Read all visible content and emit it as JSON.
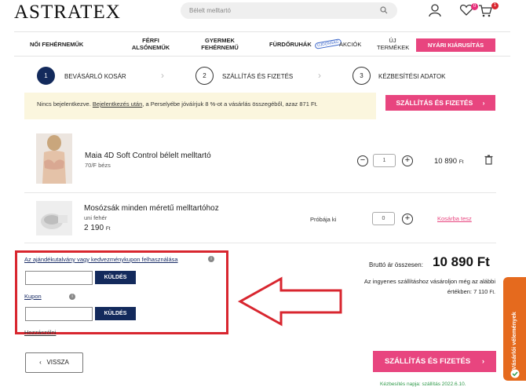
{
  "header": {
    "logo": "ASTRATEX",
    "search": {
      "placeholder": "Bélelt melltartó"
    },
    "wishlist_count": "0",
    "cart_count": "1"
  },
  "nav": {
    "items": [
      {
        "label": "NŐI FEHÉRNEMŰK"
      },
      {
        "label": "FÉRFI ALSÓNEMŰK"
      },
      {
        "label": "GYERMEK FEHÉRNEMŰ"
      },
      {
        "label": "FÜRDŐRUHÁK"
      },
      {
        "label": "AKCIÓK"
      },
      {
        "label": "ÚJ TERMÉKEK"
      }
    ],
    "new_tag": "ÚJDONSÁG",
    "sale_label": "NYÁRI KIÁRUSÍTÁS"
  },
  "steps": [
    {
      "num": "1",
      "label": "BEVÁSÁRLÓ KOSÁR"
    },
    {
      "num": "2",
      "label": "SZÁLLÍTÁS ÉS FIZETÉS"
    },
    {
      "num": "3",
      "label": "KÉZBESÍTÉSI ADATOK"
    }
  ],
  "notice": {
    "prefix": "Nincs bejelentkezve.",
    "link": "Bejelentkezés után",
    "rest": ", a Perselyébe jóváírjuk 8 %-ot a vásárlás összegéből, azaz 871 Ft.",
    "button": "SZÁLLÍTÁS ÉS FIZETÉS"
  },
  "products": [
    {
      "name": "Maia 4D Soft Control bélelt melltartó",
      "variant": "70/F bézs",
      "qty": "1",
      "price": "10 890",
      "currency": "Ft"
    },
    {
      "name": "Mosózsák minden méretű melltartóhoz",
      "variant": "uni fehér",
      "price_line": "2 190",
      "currency": "Ft",
      "try_label": "Próbája ki",
      "qty": "0",
      "add_to_cart": "Kosárba tesz"
    }
  ],
  "coupon": {
    "gift_label": "Az ajándékutalvány vagy kedvezménykupon felhasználása",
    "gift_button": "KÜLDÉS",
    "coupon_label": "Kupon",
    "coupon_button": "KÜLDÉS",
    "extra_link": "Hozzászólni"
  },
  "totals": {
    "label": "Bruttó ár összesen:",
    "value": "10 890",
    "currency": "Ft",
    "free_shipping_line1": "Az ingyenes szállításhoz vásároljon még az alábbi",
    "free_shipping_line2": "értékben: 7 110",
    "free_shipping_currency": "Ft."
  },
  "footer": {
    "back": "VISSZA",
    "continue": "SZÁLLÍTÁS ÉS FIZETÉS",
    "reviews": "Vásárlói vélemények",
    "delivery": "Kézbesítés napja: szállítás 2022.6.10."
  },
  "colors": {
    "accent": "#e8457f",
    "navy": "#132a5c",
    "annotation": "#d8262f",
    "reviews": "#e56a1e"
  }
}
